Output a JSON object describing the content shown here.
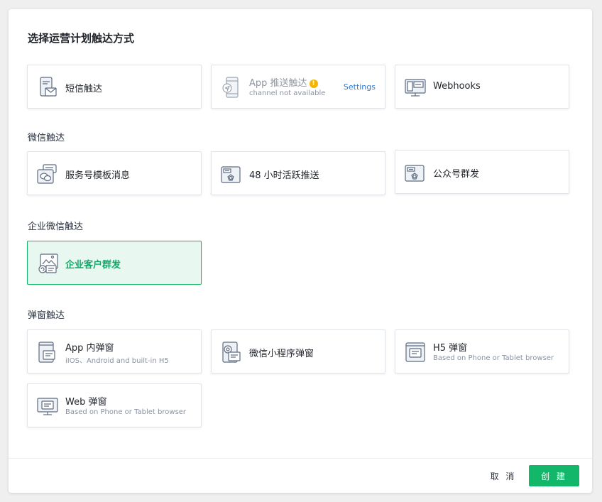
{
  "dialog": {
    "title": "选择运营计划触达方式",
    "cancel_label": "取 消",
    "create_label": "创 建"
  },
  "colors": {
    "accent": "#12b76a",
    "selected_bg": "#e8f8f0",
    "link": "#2a7ad9",
    "warning": "#f5b400"
  },
  "general": {
    "sms": {
      "name": "短信触达",
      "icon": "sms-icon"
    },
    "app_push": {
      "name": "App 推送触达",
      "sub": "channel not available",
      "settings": "Settings",
      "warn_glyph": "!",
      "icon": "app-push-icon"
    },
    "webhooks": {
      "name": "Webhooks",
      "icon": "webhooks-icon"
    }
  },
  "wechat": {
    "label": "微信触达",
    "service_template": {
      "name": "服务号模板消息",
      "icon": "wechat-service-icon"
    },
    "active_48h": {
      "name": "48 小时活跃推送",
      "icon": "wechat-active-icon"
    },
    "official_broadcast": {
      "name": "公众号群发",
      "icon": "wechat-official-icon"
    }
  },
  "work_wechat": {
    "label": "企业微信触达",
    "customer_broadcast": {
      "name": "企业客户群发",
      "icon": "work-wechat-icon"
    }
  },
  "popup": {
    "label": "弹窗触达",
    "app_popup": {
      "name": "App 内弹窗",
      "sub": "iIOS、Android and built-in H5",
      "icon": "app-popup-icon"
    },
    "mini_program": {
      "name": "微信小程序弹窗",
      "icon": "mini-program-icon"
    },
    "h5_popup": {
      "name": "H5 弹窗",
      "sub": "Based on  Phone or Tablet browser",
      "icon": "h5-popup-icon"
    },
    "web_popup": {
      "name": "Web 弹窗",
      "sub": "Based on  Phone or Tablet browser",
      "icon": "web-popup-icon"
    }
  }
}
